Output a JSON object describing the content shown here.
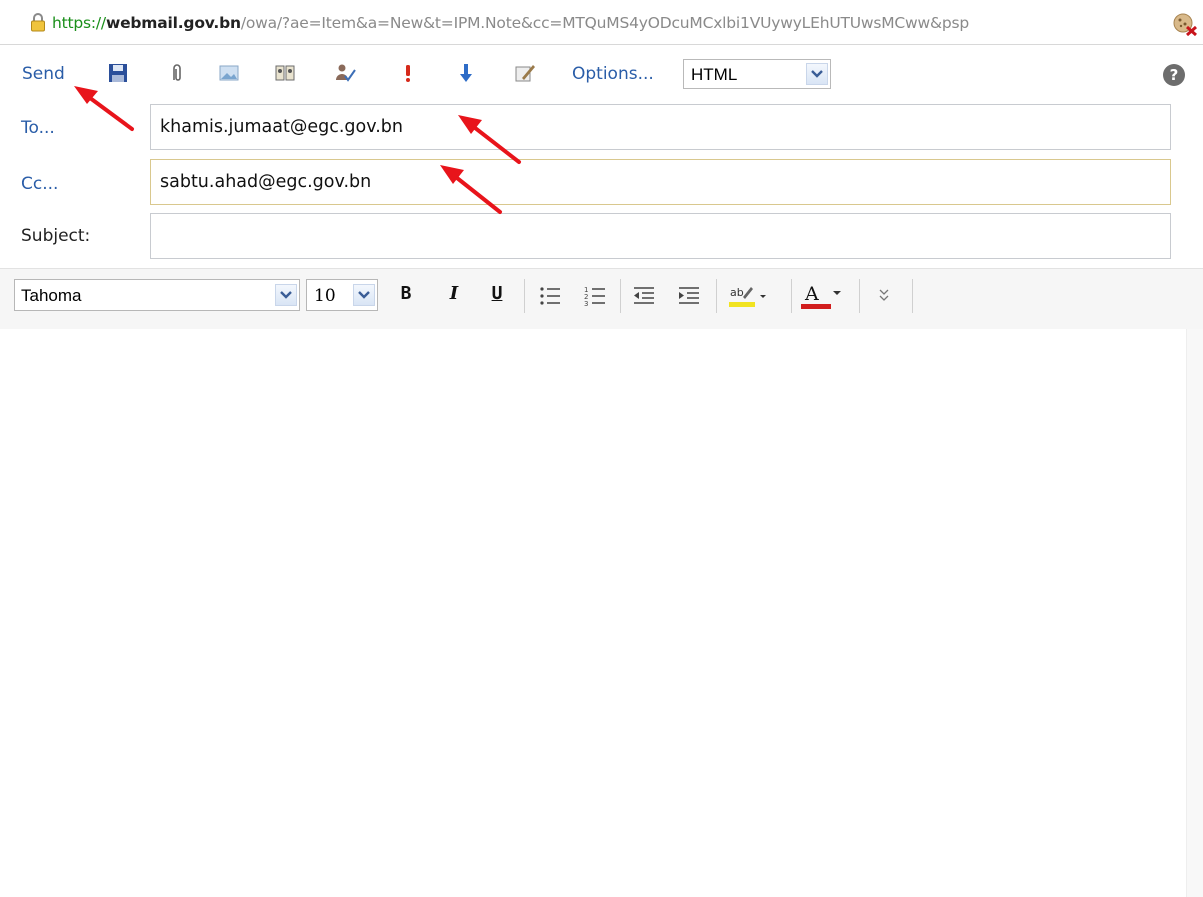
{
  "address_bar": {
    "url_scheme": "https://",
    "url_host": "webmail.gov.bn",
    "url_path": "/owa/?ae=Item&a=New&t=IPM.Note&cc=MTQuMS4yODcuMCxlbi1VUywyLEhUTUwsMCww&psp"
  },
  "toolbar": {
    "send_label": "Send",
    "options_label": "Options...",
    "format_value": "HTML",
    "help_label": "?"
  },
  "header": {
    "to_label": "To...",
    "to_value": "khamis.jumaat@egc.gov.bn",
    "cc_label": "Cc...",
    "cc_value": "sabtu.ahad@egc.gov.bn",
    "subject_label": "Subject:",
    "subject_value": ""
  },
  "format_bar": {
    "font_value": "Tahoma",
    "size_value": "10",
    "bold_label": "B",
    "italic_label": "I",
    "underline_label": "U",
    "font_color_label": "A"
  },
  "colors": {
    "accent_link": "#2a5da8",
    "annotation_arrow": "#e8141b",
    "highlight_yellow": "#f1e321",
    "font_color_red": "#d11d1d"
  }
}
